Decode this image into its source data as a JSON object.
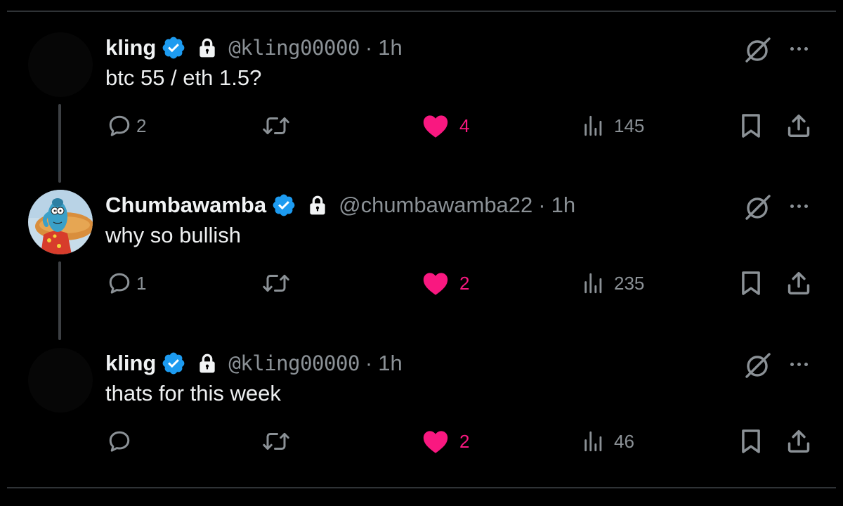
{
  "tweets": [
    {
      "name": "kling",
      "handle": "@kling00000",
      "separator": "·",
      "time": "1h",
      "text": "btc 55 / eth 1.5?",
      "replies": "2",
      "reposts": "",
      "likes": "4",
      "views": "145"
    },
    {
      "name": "Chumbawamba",
      "handle": "@chumbawamba22",
      "separator": "·",
      "time": "1h",
      "text": "why so bullish",
      "replies": "1",
      "reposts": "",
      "likes": "2",
      "views": "235"
    },
    {
      "name": "kling",
      "handle": "@kling00000",
      "separator": "·",
      "time": "1h",
      "text": "thats for this week",
      "replies": "",
      "reposts": "",
      "likes": "2",
      "views": "46"
    }
  ],
  "colors": {
    "background": "#000000",
    "verified": "#1d9bf0",
    "like": "#f91880",
    "muted": "#8b9196",
    "text": "#e7e9ea"
  },
  "icons": {
    "verified": "verified-badge-icon",
    "lock": "lock-icon",
    "grok": "grok-icon",
    "more": "more-icon",
    "reply": "reply-icon",
    "repost": "repost-icon",
    "like": "heart-icon",
    "views": "views-icon",
    "bookmark": "bookmark-icon",
    "share": "share-icon"
  }
}
